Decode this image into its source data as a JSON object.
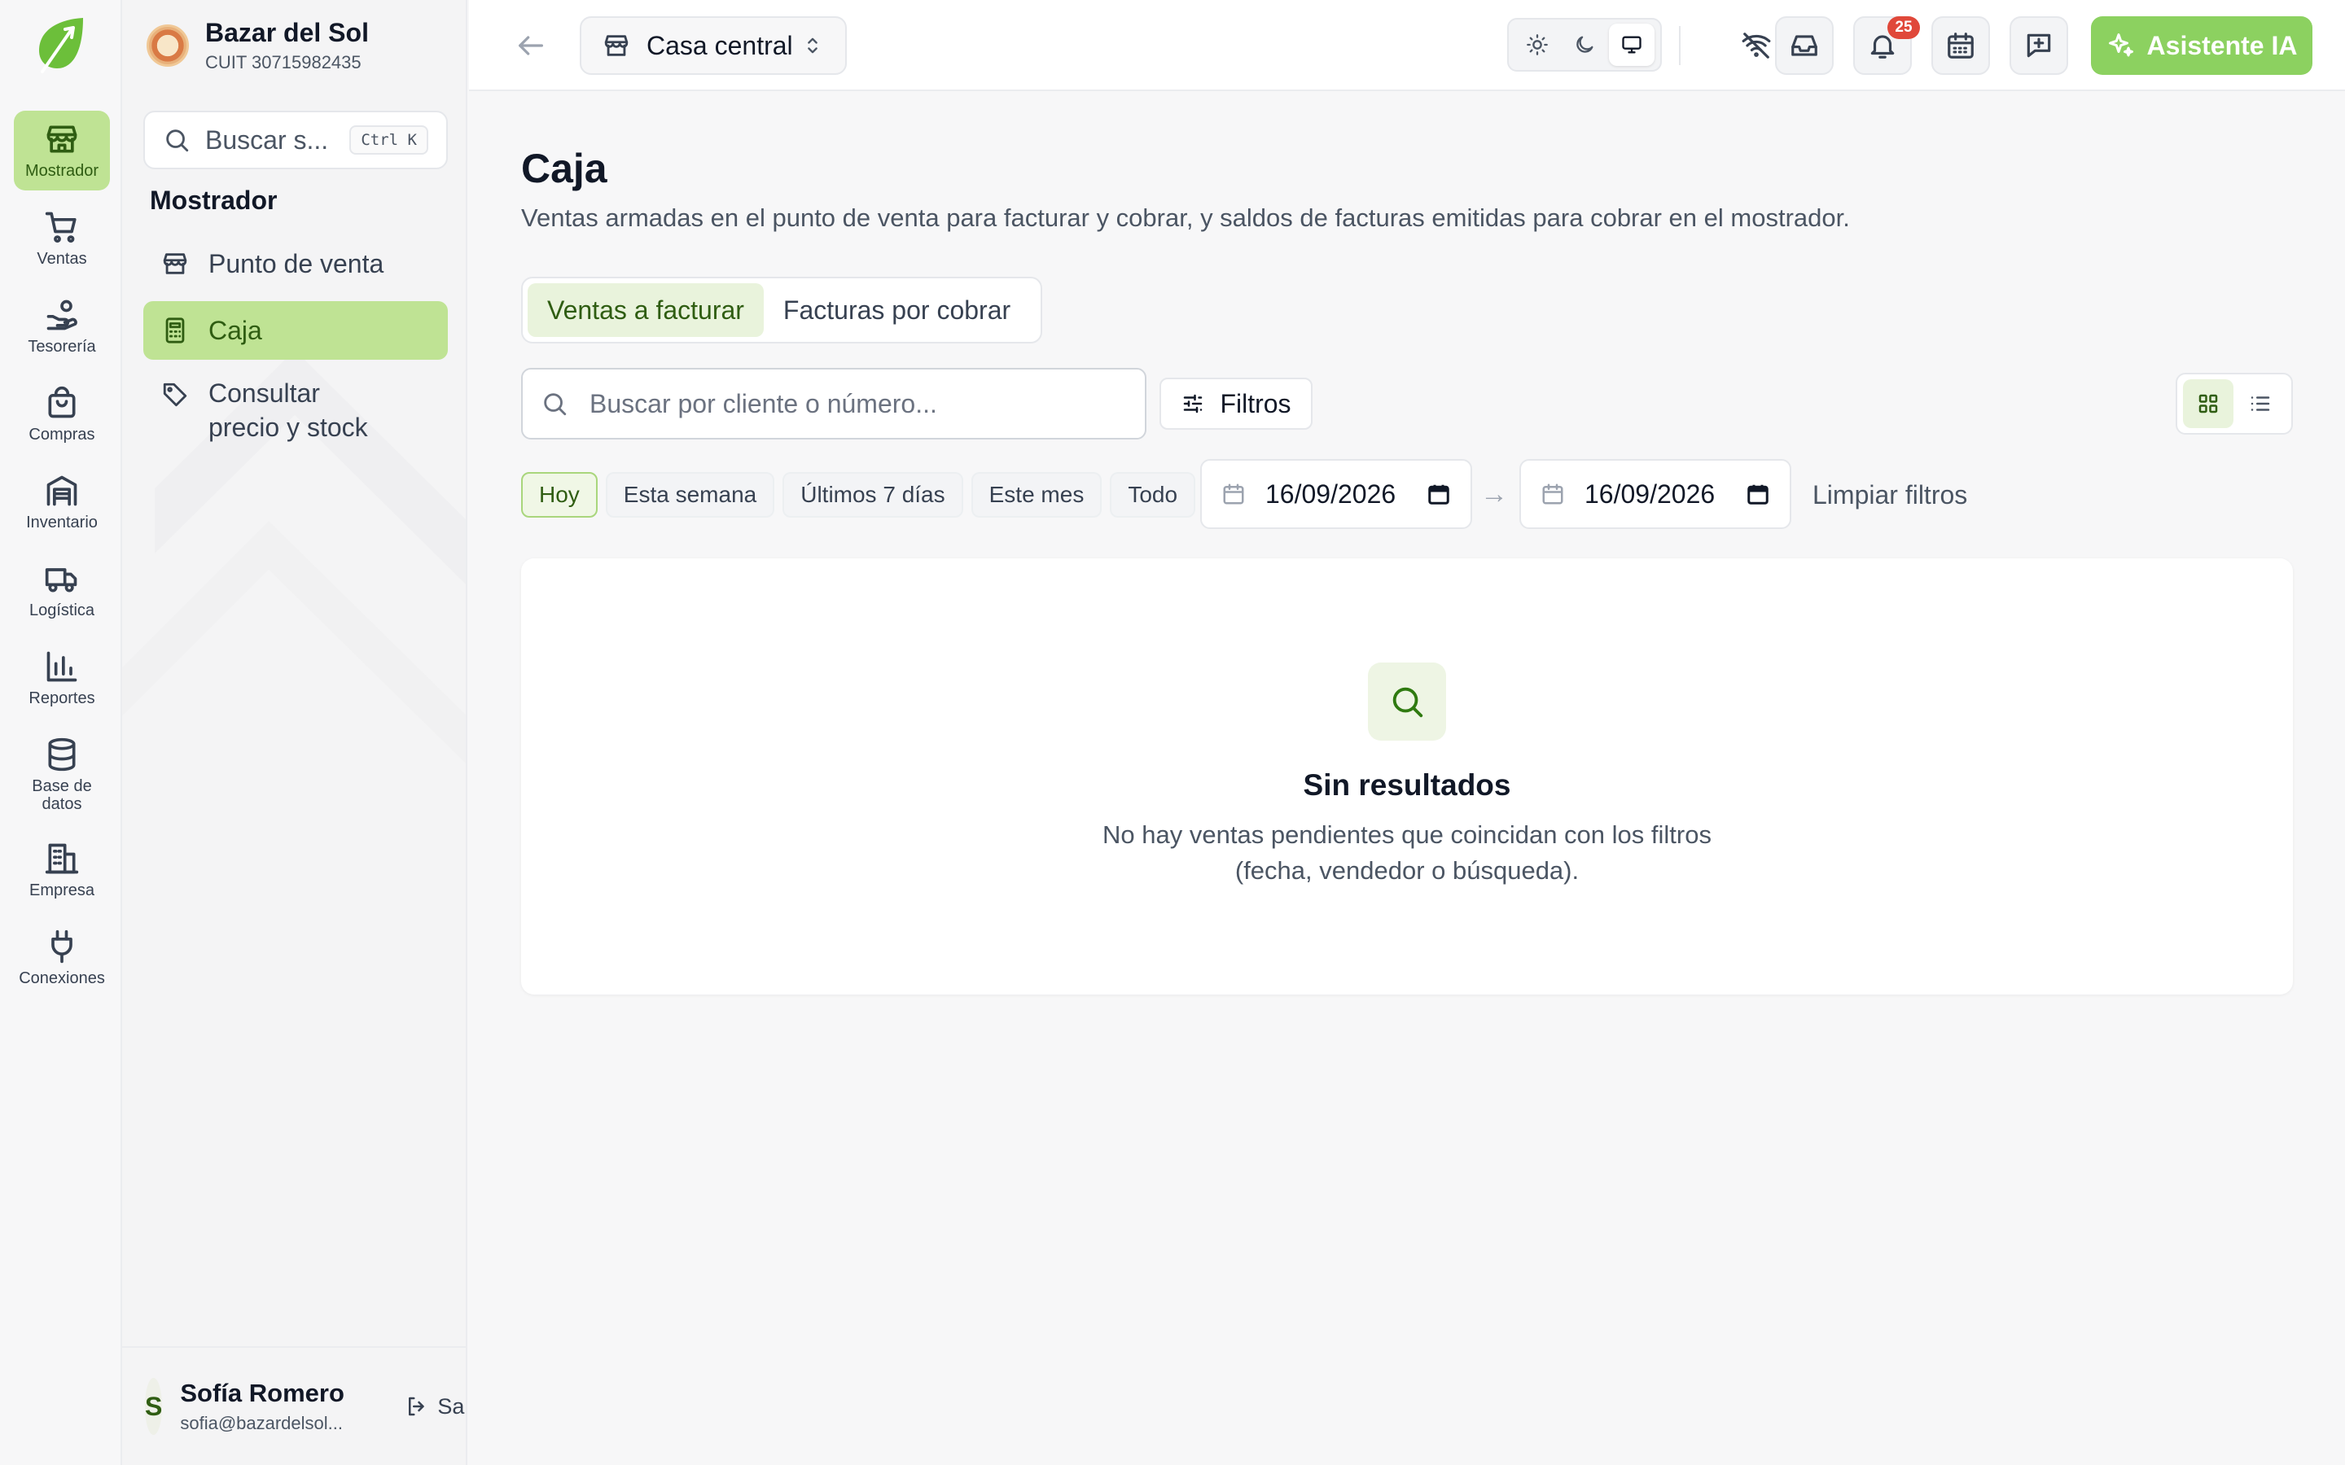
{
  "rail": {
    "items": [
      {
        "label": "Mostrador",
        "icon": "store-icon",
        "active": true
      },
      {
        "label": "Ventas",
        "icon": "cart-icon"
      },
      {
        "label": "Tesorería",
        "icon": "hand-coins-icon"
      },
      {
        "label": "Compras",
        "icon": "shopping-bag-icon"
      },
      {
        "label": "Inventario",
        "icon": "warehouse-icon"
      },
      {
        "label": "Logística",
        "icon": "truck-icon"
      },
      {
        "label": "Reportes",
        "icon": "bar-chart-icon"
      },
      {
        "label": "Base de datos",
        "icon": "database-icon"
      },
      {
        "label": "Empresa",
        "icon": "building-icon"
      },
      {
        "label": "Conexiones",
        "icon": "plug-icon"
      }
    ]
  },
  "company": {
    "name": "Bazar del Sol",
    "cuit": "CUIT 30715982435"
  },
  "sidebar": {
    "search_placeholder": "Buscar s...",
    "shortcut": "Ctrl K",
    "section_title": "Mostrador",
    "items": [
      {
        "label": "Punto de venta",
        "icon": "store-icon"
      },
      {
        "label": "Caja",
        "icon": "calculator-icon",
        "active": true
      },
      {
        "label": "Consultar precio y stock",
        "icon": "tag-icon"
      }
    ]
  },
  "user": {
    "initial": "S",
    "name": "Sofía Romero",
    "email": "sofia@bazardelsol...",
    "logout_label": "Salir"
  },
  "topbar": {
    "branch": "Casa central",
    "notifications_count": "25",
    "ai_button": "Asistente IA"
  },
  "page": {
    "title": "Caja",
    "description": "Ventas armadas en el punto de venta para facturar y cobrar, y saldos de facturas emitidas para cobrar en el mostrador.",
    "tabs": [
      {
        "label": "Ventas a facturar",
        "active": true
      },
      {
        "label": "Facturas por cobrar"
      }
    ],
    "search_placeholder": "Buscar por cliente o número...",
    "filters_label": "Filtros",
    "chips": [
      {
        "label": "Hoy",
        "active": true
      },
      {
        "label": "Esta semana"
      },
      {
        "label": "Últimos 7 días"
      },
      {
        "label": "Este mes"
      },
      {
        "label": "Todo"
      }
    ],
    "date_from": "16/09/2026",
    "date_to": "16/09/2026",
    "date_arrow": "→",
    "clear_filters": "Limpiar filtros",
    "empty": {
      "title": "Sin resultados",
      "description": "No hay ventas pendientes que coincidan con los filtros (fecha, vendedor o búsqueda)."
    }
  },
  "colors": {
    "accent": "#8cd160",
    "active_bg": "#bfe394",
    "badge": "#e0483a"
  }
}
